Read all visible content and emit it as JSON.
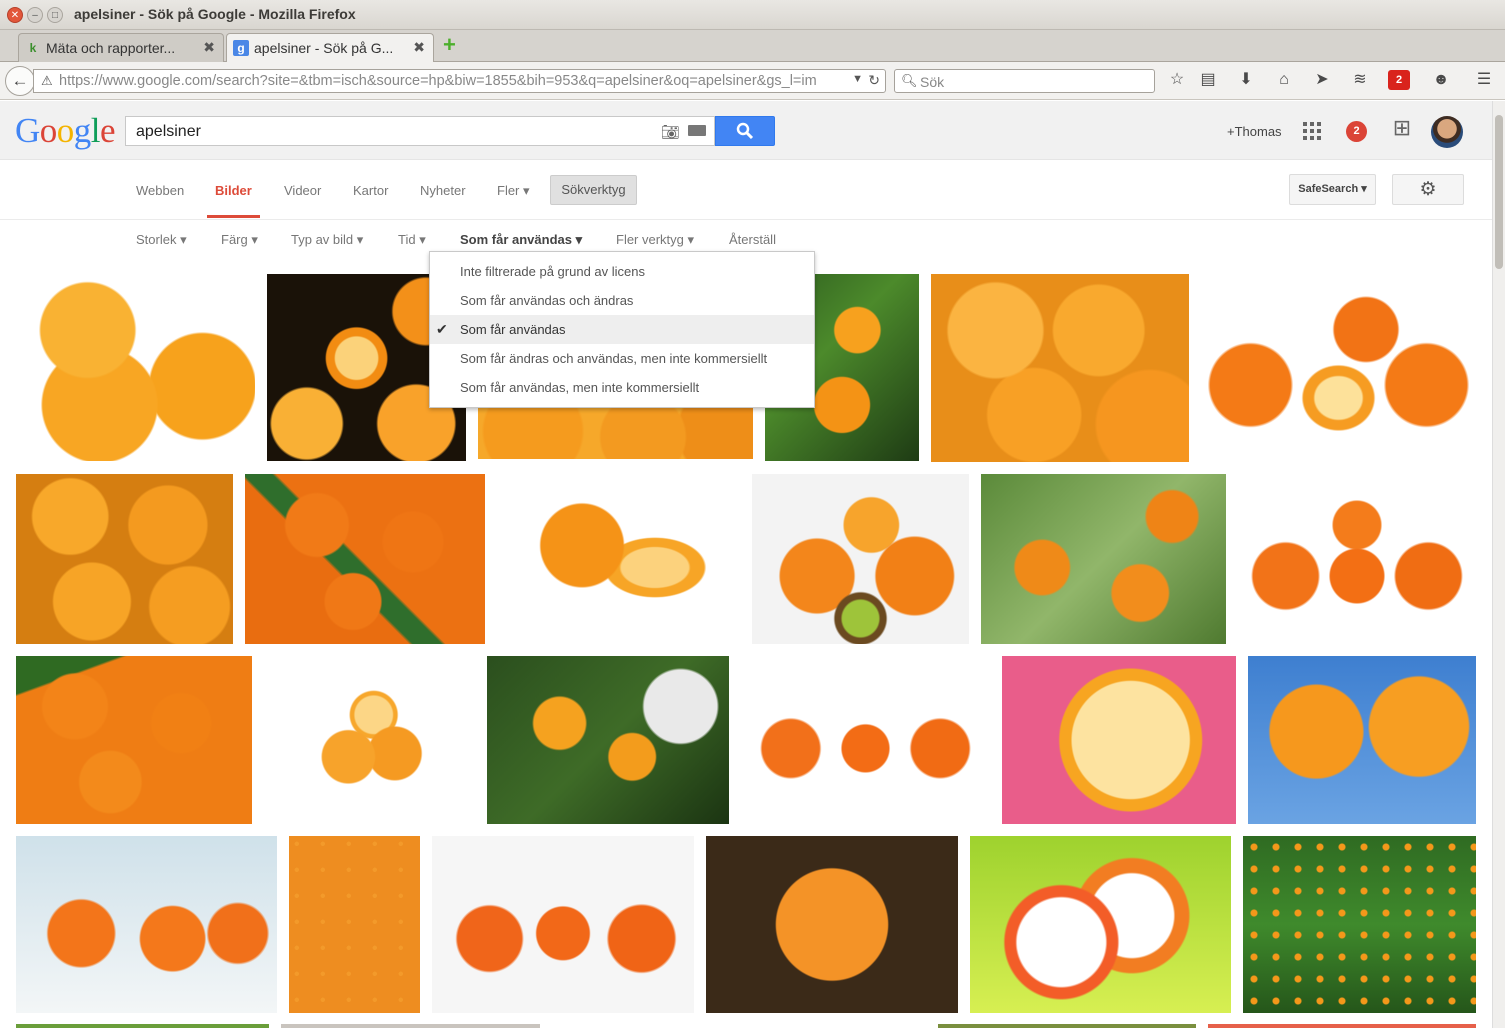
{
  "window": {
    "title": "apelsiner - Sök på Google - Mozilla Firefox"
  },
  "browser_tabs": [
    {
      "label": "Mäta och rapporter...",
      "favicon": "k",
      "close": "✖"
    },
    {
      "label": "apelsiner - Sök på G...",
      "favicon": "g",
      "close": "✖"
    }
  ],
  "nav": {
    "url": "https://www.google.com/search?site=&tbm=isch&source=hp&biw=1855&bih=953&q=apelsiner&oq=apelsiner&gs_l=im",
    "search_placeholder": "Sök",
    "ff_badge": "2"
  },
  "google": {
    "logo": [
      "G",
      "o",
      "o",
      "g",
      "l",
      "e"
    ],
    "logo_colors": [
      "#4285f4",
      "#db4437",
      "#f4b400",
      "#4285f4",
      "#0f9d58",
      "#db4437"
    ],
    "query": "apelsiner",
    "user": "+Thomas",
    "notifications": "2",
    "tabs": [
      "Webben",
      "Bilder",
      "Videor",
      "Kartor",
      "Nyheter",
      "Fler"
    ],
    "tools_button": "Sökverktyg",
    "safesearch": "SafeSearch",
    "tools": [
      "Storlek",
      "Färg",
      "Typ av bild",
      "Tid",
      "Som får användas",
      "Fler verktyg",
      "Återställ"
    ]
  },
  "license_menu": {
    "items": [
      "Inte filtrerade på grund av licens",
      "Som får användas och ändras",
      "Som får användas",
      "Som får ändras och användas, men inte kommersiellt",
      "Som får användas, men inte kommersiellt"
    ],
    "selected_index": 2
  },
  "colors": {
    "accent_red": "#dd4b39",
    "search_blue": "#4285f4",
    "orange": "#f7941d"
  }
}
